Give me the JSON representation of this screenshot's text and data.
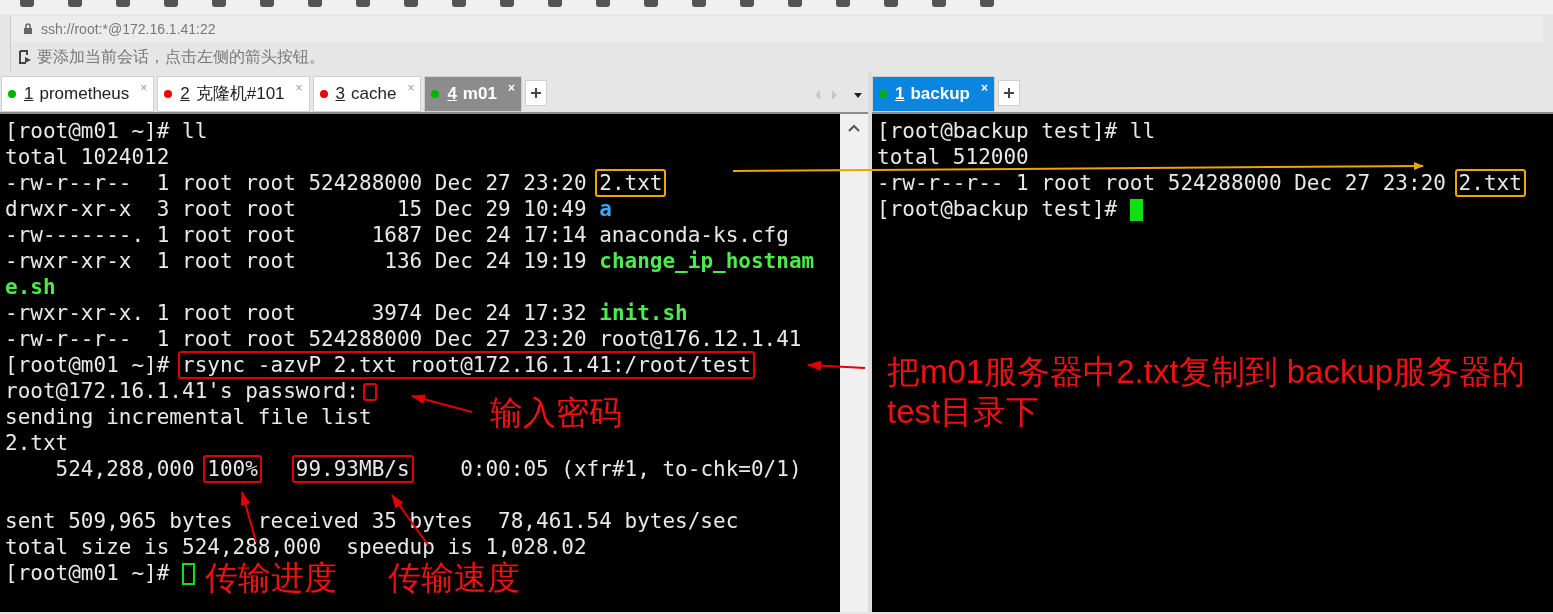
{
  "address_bar": {
    "text": "ssh://root:*@172.16.1.41:22"
  },
  "hint_bar": {
    "text": "要添加当前会话，点击左侧的箭头按钮。"
  },
  "left_tabs": [
    {
      "number": "1",
      "label": "prometheus",
      "color": "#00b400",
      "selected": false,
      "close": "×"
    },
    {
      "number": "2",
      "label": "克隆机#101",
      "color": "#f00000",
      "selected": false,
      "close": "×"
    },
    {
      "number": "3",
      "label": "cache",
      "color": "#f00000",
      "selected": false,
      "close": "×"
    },
    {
      "number": "4",
      "label": "m01",
      "color": "#00b400",
      "selected": true,
      "close": "×"
    }
  ],
  "right_tabs": [
    {
      "number": "1",
      "label": "backup",
      "color": "#00b400",
      "selected": true,
      "close": "×"
    }
  ],
  "left_terminal": [
    [
      {
        "kind": "text",
        "text": "[root@m01 ~]# ll"
      }
    ],
    [
      {
        "kind": "text",
        "text": "total 1024012"
      }
    ],
    [
      {
        "kind": "text",
        "text": "-rw-r--r--  1 root root 524288000 Dec 27 23:20 "
      },
      {
        "kind": "text",
        "text": "2.txt",
        "color": "#f0a400"
      }
    ],
    [
      {
        "kind": "text",
        "text": "drwxr-xr-x  3 root root        15 Dec 29 10:49 "
      },
      {
        "kind": "dir",
        "text": "a"
      }
    ],
    [
      {
        "kind": "text",
        "text": "-rw-------. 1 root root      1687 Dec 24 17:14 anaconda-ks.cfg"
      }
    ],
    [
      {
        "kind": "text",
        "text": "-rwxr-xr-x  1 root root       136 Dec 24 19:19 "
      },
      {
        "kind": "exec",
        "text": "change_ip_hostnam"
      }
    ],
    [
      {
        "kind": "exec",
        "text": "e.sh"
      }
    ],
    [
      {
        "kind": "text",
        "text": "-rwxr-xr-x. 1 root root      3974 Dec 24 17:32 "
      },
      {
        "kind": "exec",
        "text": "init.sh"
      }
    ],
    [
      {
        "kind": "text",
        "text": "-rw-r--r--  1 root root 524288000 Dec 27 23:20 root@176.12.1.41"
      }
    ],
    [
      {
        "kind": "text",
        "text": "[root@m01 ~]# "
      },
      {
        "kind": "text",
        "text": "rsync -azvP 2.txt root@172.16.1.41:/root/test",
        "color": "#e00000"
      }
    ],
    [
      {
        "kind": "text",
        "text": "root@172.16.1.41's password:"
      },
      {
        "kind": "mark",
        "color": "#e00000"
      }
    ],
    [
      {
        "kind": "text",
        "text": "sending incremental file list"
      }
    ],
    [
      {
        "kind": "text",
        "text": "2.txt"
      }
    ],
    [
      {
        "kind": "text",
        "text": "    524,288,000 "
      },
      {
        "kind": "text",
        "text": "100%",
        "color": "#e00000"
      },
      {
        "kind": "gap"
      },
      {
        "kind": "text",
        "text": "99.93MB/s",
        "color": "#e00000"
      },
      {
        "kind": "text",
        "text": "    0:00:05 (xfr#1, to-chk=0/1)"
      },
      {
        "kind": "blank_line"
      }
    ],
    [
      {
        "kind": "text",
        "text": "sent 509,965 bytes  received 35 bytes  78,461.54 bytes/sec"
      }
    ],
    [
      {
        "kind": "text",
        "text": "total size is 524,288,000  speedup is 1,028.02"
      }
    ],
    [
      {
        "kind": "text",
        "text": "[root@m01 ~]# "
      },
      {
        "kind": "hollow_cursor"
      }
    ]
  ],
  "right_terminal": [
    [
      {
        "kind": "text",
        "text": "[root@backup test]# ll"
      }
    ],
    [
      {
        "kind": "text",
        "text": "total 512000"
      }
    ],
    [
      {
        "kind": "text",
        "text": "-rw-r--r-- 1 root root 524288000 Dec 27 23:20 "
      },
      {
        "kind": "text",
        "text": "2.txt",
        "color": "#f0a400"
      }
    ],
    [
      {
        "kind": "text",
        "text": "[root@backup test]# "
      },
      {
        "kind": "cursor"
      }
    ]
  ],
  "annotations": [
    {
      "kind": "password_note",
      "text": "输入密码"
    },
    {
      "kind": "copy_note",
      "text": "把m01服务器中2.txt复制到 backup服务器的test目录下"
    },
    {
      "kind": "progress_note",
      "text": "传输进度"
    },
    {
      "kind": "speed_note",
      "text": "传输速度"
    }
  ]
}
